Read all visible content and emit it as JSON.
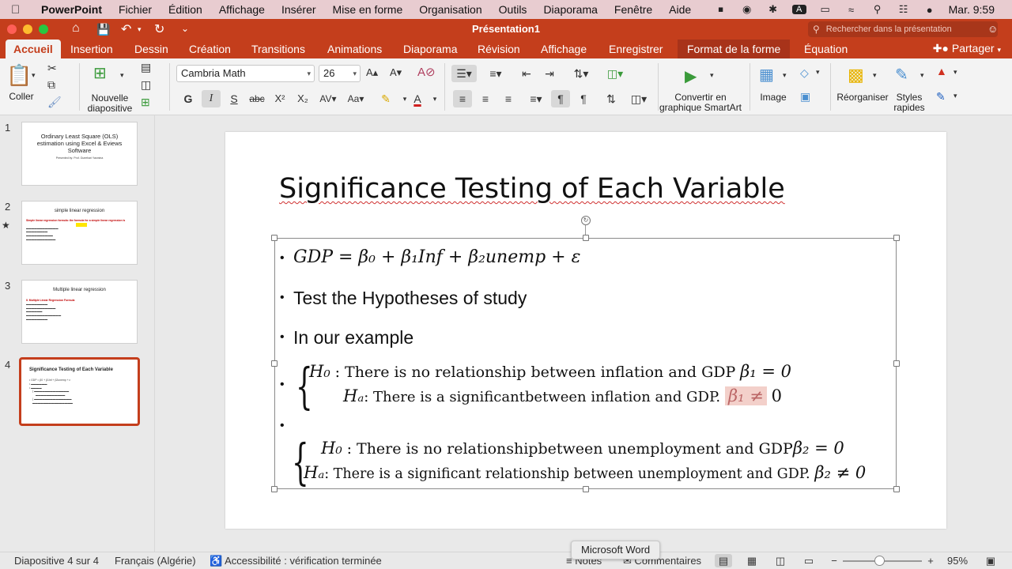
{
  "menubar": {
    "app": "PowerPoint",
    "items": [
      "Fichier",
      "Édition",
      "Affichage",
      "Insérer",
      "Mise en forme",
      "Organisation",
      "Outils",
      "Diaporama",
      "Fenêtre",
      "Aide"
    ],
    "clock": "Mar. 9:59"
  },
  "window": {
    "title": "Présentation1",
    "search_placeholder": "Rechercher dans la présentation"
  },
  "ribbon": {
    "tabs": [
      "Accueil",
      "Insertion",
      "Dessin",
      "Création",
      "Transitions",
      "Animations",
      "Diaporama",
      "Révision",
      "Affichage",
      "Enregistrer",
      "Format de la forme",
      "Équation"
    ],
    "active_tab": "Accueil",
    "share": "Partager",
    "paste_label": "Coller",
    "new_slide_label_1": "Nouvelle",
    "new_slide_label_2": "diapositive",
    "font_name": "Cambria Math",
    "font_size": "26",
    "format_buttons": [
      "G",
      "I",
      "S",
      "abc",
      "X²",
      "X₂"
    ],
    "convert_label_1": "Convertir en",
    "convert_label_2": "graphique SmartArt",
    "image_label": "Image",
    "arrange_label": "Réorganiser",
    "styles_label_1": "Styles",
    "styles_label_2": "rapides"
  },
  "thumbnails": [
    {
      "number": "1",
      "title": "Ordinary Least Square (OLS) estimation using Excel & Eviews Software",
      "sub": "Presented by: Prof. Gueehari Yasmina"
    },
    {
      "number": "2",
      "title": "simple linear regression",
      "sub": "Simple linear regression formula: the formula for a simple linear regression is"
    },
    {
      "number": "3",
      "title": "Multiple linear regression",
      "sub": "II. Multiple Linear Regression Formula"
    },
    {
      "number": "4",
      "title": "Significance Testing of Each Variable",
      "sub": "GDP = β0 + β1Inf + β2unemp + ε"
    }
  ],
  "slide": {
    "title": "Significance Testing of Each Variable",
    "eq_main": "GDP = β₀ + β₁Inf + β₂unemp + ε",
    "bullet_2": "Test the Hypotheses of study",
    "bullet_3": "In our example",
    "h0_1_sym": "H₀",
    "h0_1_text": ": There is no relationship between inflation and GDP",
    "h0_1_eq": "β₁ = 0",
    "ha_1_sym": "Hₐ",
    "ha_1_text": ": There is a significantbetween inflation and GDP.",
    "ha_1_eq": "β₁ ≠",
    "ha_1_end": "0",
    "h0_2_sym": "H₀",
    "h0_2_text": ": There is no relationshipbetween unemployment and GDP",
    "h0_2_eq": "β₂ = 0",
    "ha_2_sym": "Hₐ",
    "ha_2_text": ": There is a significant relationship between unemployment and GDP.",
    "ha_2_eq": "β₂ ≠ 0"
  },
  "statusbar": {
    "slide_info": "Diapositive 4 sur 4",
    "language": "Français (Algérie)",
    "accessibility": "Accessibilité : vérification terminée",
    "notes": "Notes",
    "comments": "Commentaires",
    "zoom": "95%",
    "tooltip": "Microsoft Word"
  },
  "colors": {
    "accent": "#c43e1c",
    "menubar_bg": "#e8ccd0",
    "highlight": "#f3d0ca"
  }
}
